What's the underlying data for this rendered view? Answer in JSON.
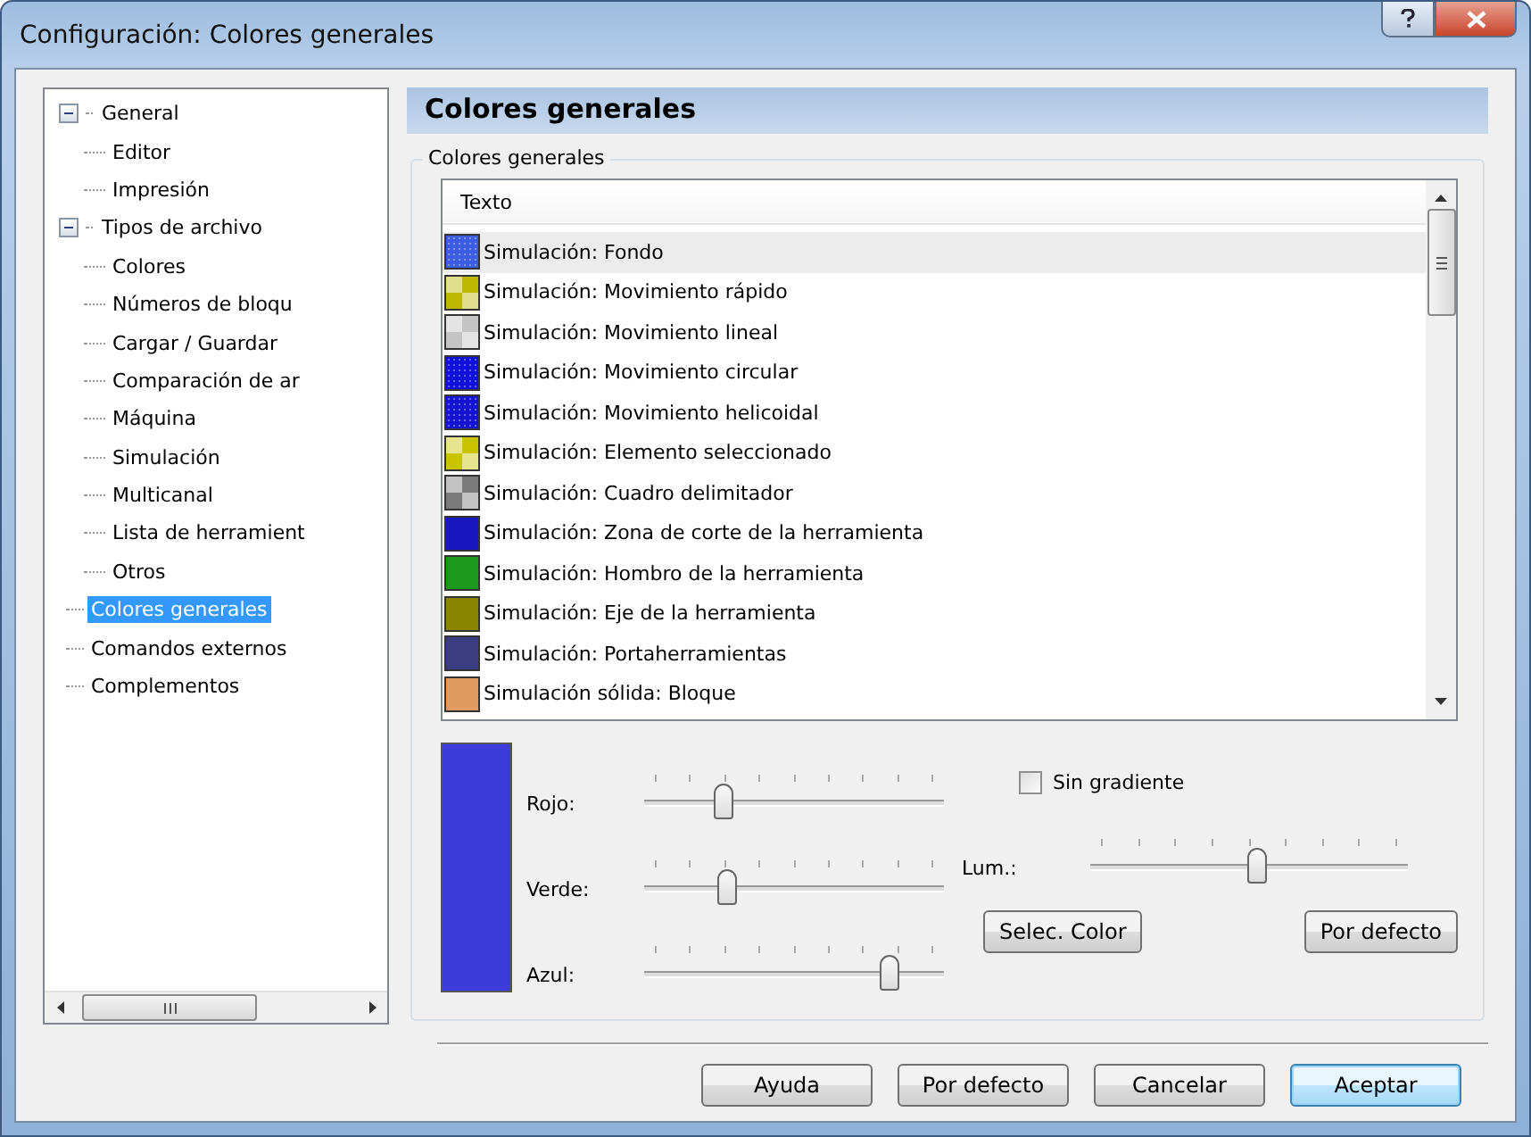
{
  "window": {
    "title": "Configuración: Colores generales"
  },
  "tree": [
    {
      "label": "General",
      "expanded": true,
      "selected": false,
      "children": [
        {
          "label": "Editor",
          "selected": false
        },
        {
          "label": "Impresión",
          "selected": false
        }
      ]
    },
    {
      "label": "Tipos de archivo",
      "expanded": true,
      "selected": false,
      "children": [
        {
          "label": "Colores",
          "selected": false
        },
        {
          "label": "Números de bloqu",
          "selected": false
        },
        {
          "label": "Cargar / Guardar",
          "selected": false
        },
        {
          "label": "Comparación de ar",
          "selected": false
        },
        {
          "label": "Máquina",
          "selected": false
        },
        {
          "label": "Simulación",
          "selected": false
        },
        {
          "label": "Multicanal",
          "selected": false
        },
        {
          "label": "Lista de herramient",
          "selected": false
        },
        {
          "label": "Otros",
          "selected": false
        }
      ]
    },
    {
      "label": "Colores generales",
      "selected": true
    },
    {
      "label": "Comandos externos",
      "selected": false
    },
    {
      "label": "Complementos",
      "selected": false
    }
  ],
  "panel": {
    "title": "Colores generales",
    "group_label": "Colores generales",
    "list": {
      "column": "Texto",
      "rows": [
        {
          "label": "Simulación: Fondo",
          "kind": "dotted",
          "color": "#3a5ce0",
          "selected": true
        },
        {
          "label": "Simulación: Movimiento rápido",
          "kind": "checker",
          "color": "#bdb800",
          "selected": false
        },
        {
          "label": "Simulación: Movimiento lineal",
          "kind": "checker",
          "color": "#c4c4c4",
          "selected": false
        },
        {
          "label": "Simulación: Movimiento circular",
          "kind": "dotted",
          "color": "#1010d8",
          "selected": false
        },
        {
          "label": "Simulación: Movimiento helicoidal",
          "kind": "dotted",
          "color": "#1414d0",
          "selected": false
        },
        {
          "label": "Simulación: Elemento seleccionado",
          "kind": "checker",
          "color": "#c8c400",
          "selected": false
        },
        {
          "label": "Simulación: Cuadro delimitador",
          "kind": "checker",
          "color": "#7a7a7a",
          "selected": false
        },
        {
          "label": "Simulación: Zona de corte de la herramienta",
          "kind": "solid",
          "color": "#1818c0",
          "selected": false
        },
        {
          "label": "Simulación: Hombro de la herramienta",
          "kind": "solid",
          "color": "#1c9a1c",
          "selected": false
        },
        {
          "label": "Simulación: Eje de la herramienta",
          "kind": "solid",
          "color": "#8a8600",
          "selected": false
        },
        {
          "label": "Simulación: Portaherramientas",
          "kind": "solid",
          "color": "#3c3c80",
          "selected": false
        },
        {
          "label": "Simulación sólida: Bloque",
          "kind": "solid",
          "color": "#e09a60",
          "selected": false
        }
      ]
    },
    "preview": {
      "color": "#3c3cd8"
    },
    "sliders": [
      {
        "label": "Rojo:",
        "level": 0.27
      },
      {
        "label": "Verde:",
        "level": 0.28
      },
      {
        "label": "Azul:",
        "level": 0.82
      }
    ],
    "no_gradient": {
      "label": "Sin gradiente",
      "checked": false
    },
    "lum": {
      "label": "Lum.:",
      "level": 0.53
    },
    "buttons": [
      "Selec. Color",
      "Por defecto"
    ]
  },
  "buttons": [
    {
      "label": "Ayuda",
      "default": false
    },
    {
      "label": "Por defecto",
      "default": false
    },
    {
      "label": "Cancelar",
      "default": false
    },
    {
      "label": "Aceptar",
      "default": true
    }
  ]
}
